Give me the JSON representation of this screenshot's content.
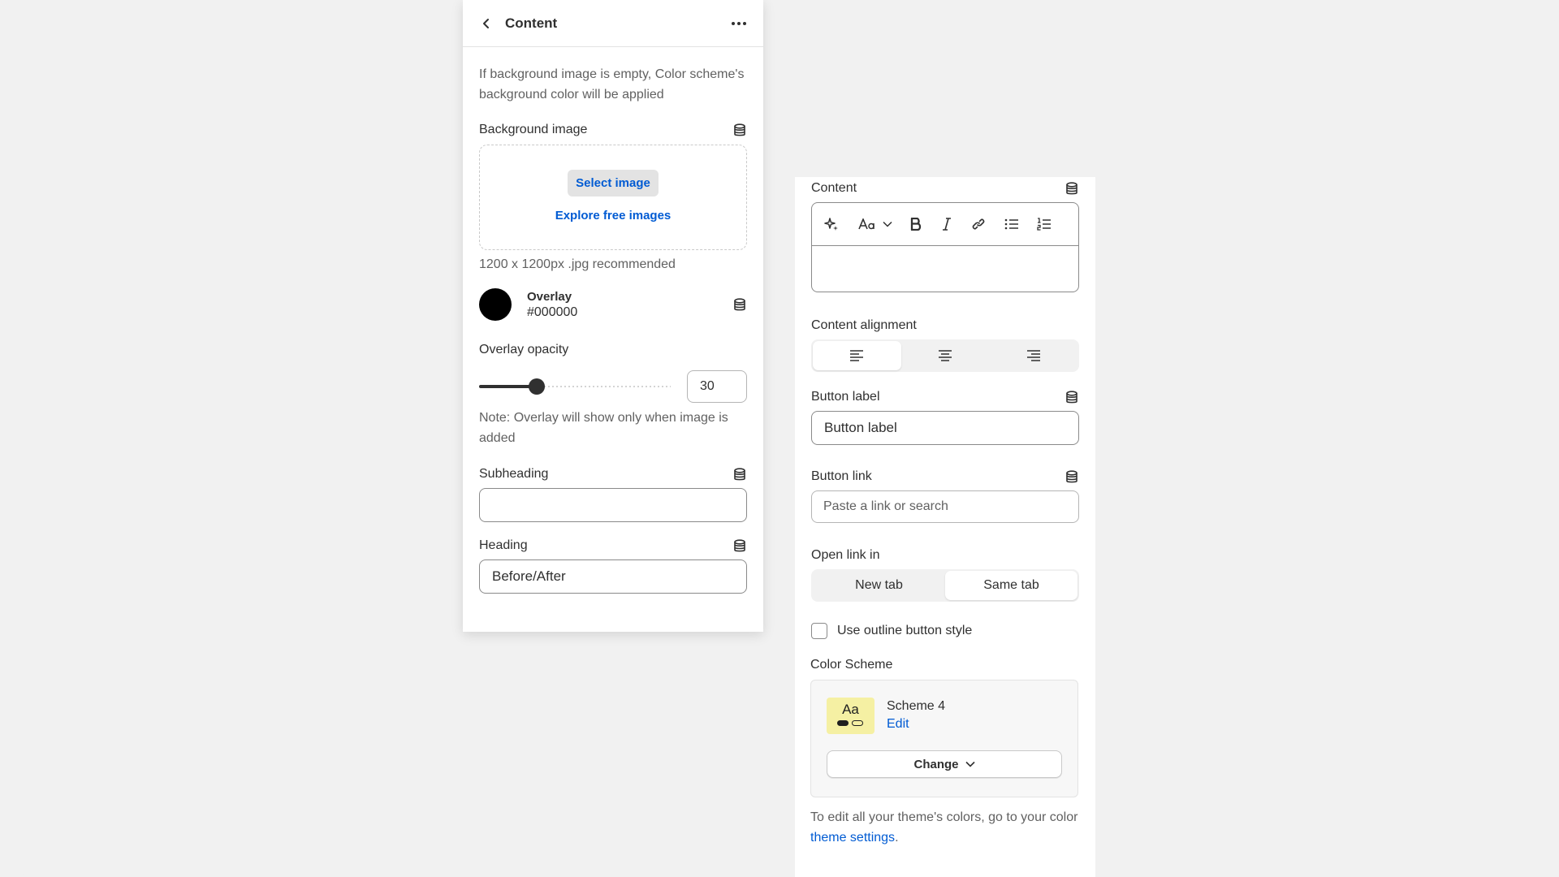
{
  "left_panel": {
    "header": {
      "title": "Content"
    },
    "info_text": "If background image is empty, Color scheme's background color will be applied",
    "background_image": {
      "label": "Background image",
      "select_label": "Select image",
      "explore_label": "Explore free images",
      "hint": "1200 x 1200px .jpg recommended"
    },
    "overlay": {
      "name": "Overlay",
      "hex": "#000000",
      "color": "#000000"
    },
    "overlay_opacity": {
      "label": "Overlay opacity",
      "value": "30",
      "fraction": 0.3
    },
    "note": "Note: Overlay will show only when image is added",
    "subheading": {
      "label": "Subheading",
      "value": ""
    },
    "heading": {
      "label": "Heading",
      "value": "Before/After"
    }
  },
  "right_panel": {
    "content": {
      "label": "Content"
    },
    "content_alignment": {
      "label": "Content alignment",
      "selected": "left"
    },
    "button_label": {
      "label": "Button label",
      "value": "Button label"
    },
    "button_link": {
      "label": "Button link",
      "placeholder": "Paste a link or search"
    },
    "open_link_in": {
      "label": "Open link in",
      "options": [
        "New tab",
        "Same tab"
      ],
      "selected": "Same tab"
    },
    "outline_style": {
      "label": "Use outline button style",
      "checked": false
    },
    "color_scheme": {
      "label": "Color Scheme",
      "preview_text": "Aa",
      "name": "Scheme 4",
      "edit_label": "Edit",
      "change_label": "Change"
    },
    "footer": {
      "text": "To edit all your theme's colors, go to your color ",
      "link": "theme settings",
      "end": "."
    }
  },
  "colors": {
    "accent_link": "#005bd3",
    "text": "#303030",
    "muted": "#616161",
    "scheme_bg": "#f5f0a3"
  }
}
